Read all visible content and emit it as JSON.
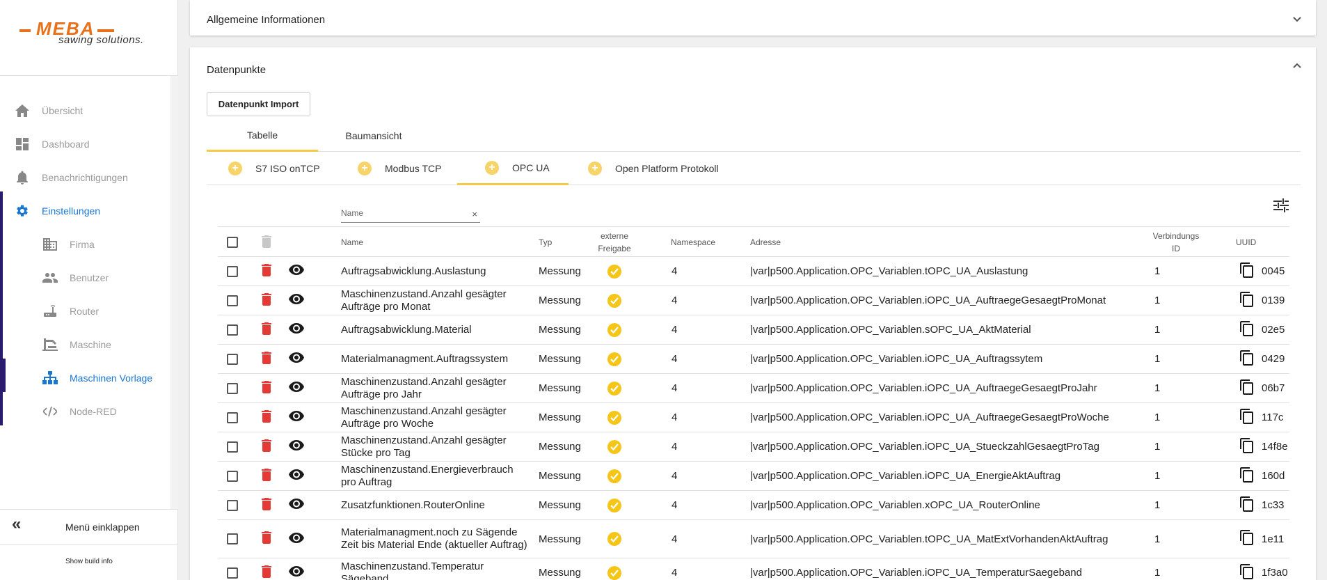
{
  "logo": {
    "brand": "MEBA",
    "tagline": "sawing solutions."
  },
  "sidebar": {
    "items": [
      {
        "label": "Übersicht",
        "icon": "home-icon"
      },
      {
        "label": "Dashboard",
        "icon": "dashboard-icon"
      },
      {
        "label": "Benachrichtigungen",
        "icon": "bell-icon"
      },
      {
        "label": "Einstellungen",
        "icon": "gear-icon"
      },
      {
        "label": "Firma",
        "icon": "building-icon"
      },
      {
        "label": "Benutzer",
        "icon": "users-icon"
      },
      {
        "label": "Router",
        "icon": "router-icon"
      },
      {
        "label": "Maschine",
        "icon": "saw-machine-icon"
      },
      {
        "label": "Maschinen Vorlage",
        "icon": "hierarchy-icon"
      },
      {
        "label": "Node-RED",
        "icon": "code-icon"
      }
    ],
    "collapse_label": "Menü einklappen",
    "build_info": "Show build info"
  },
  "panel_general": {
    "title": "Allgemeine Informationen"
  },
  "panel_datapoints": {
    "title": "Datenpunkte",
    "import_button": "Datenpunkt Import",
    "view_tabs": [
      "Tabelle",
      "Baumansicht"
    ],
    "protocol_tabs": [
      "S7 ISO onTCP",
      "Modbus TCP",
      "OPC UA",
      "Open Platform Protokoll"
    ],
    "filter": {
      "placeholder": "Name",
      "clear": "×"
    }
  },
  "table": {
    "headers": {
      "name": "Name",
      "type": "Typ",
      "external_1": "externe",
      "external_2": "Freigabe",
      "namespace": "Namespace",
      "address": "Adresse",
      "connection_1": "Verbindungs",
      "connection_2": "ID",
      "uuid": "UUID"
    },
    "rows": [
      {
        "name": "Auftragsabwicklung.Auslastung",
        "type": "Messung",
        "namespace": "4",
        "address": "|var|p500.Application.OPC_Variablen.tOPC_UA_Auslastung",
        "conn": "1",
        "uuid": "0045"
      },
      {
        "name": "Maschinenzustand.Anzahl gesägter Aufträge pro Monat",
        "type": "Messung",
        "namespace": "4",
        "address": "|var|p500.Application.OPC_Variablen.iOPC_UA_AuftraegeGesaegtProMonat",
        "conn": "1",
        "uuid": "0139"
      },
      {
        "name": "Auftragsabwicklung.Material",
        "type": "Messung",
        "namespace": "4",
        "address": "|var|p500.Application.OPC_Variablen.sOPC_UA_AktMaterial",
        "conn": "1",
        "uuid": "02e5"
      },
      {
        "name": "Materialmanagment.Auftragssystem",
        "type": "Messung",
        "namespace": "4",
        "address": "|var|p500.Application.OPC_Variablen.iOPC_UA_Auftragssytem",
        "conn": "1",
        "uuid": "0429"
      },
      {
        "name": "Maschinenzustand.Anzahl gesägter Aufträge pro Jahr",
        "type": "Messung",
        "namespace": "4",
        "address": "|var|p500.Application.OPC_Variablen.iOPC_UA_AuftraegeGesaegtProJahr",
        "conn": "1",
        "uuid": "06b7"
      },
      {
        "name": "Maschinenzustand.Anzahl gesägter Aufträge pro Woche",
        "type": "Messung",
        "namespace": "4",
        "address": "|var|p500.Application.OPC_Variablen.iOPC_UA_AuftraegeGesaegtProWoche",
        "conn": "1",
        "uuid": "117c"
      },
      {
        "name": "Maschinenzustand.Anzahl gesägter Stücke pro Tag",
        "type": "Messung",
        "namespace": "4",
        "address": "|var|p500.Application.OPC_Variablen.iOPC_UA_StueckzahlGesaegtProTag",
        "conn": "1",
        "uuid": "14f8e"
      },
      {
        "name": "Maschinenzustand.Energieverbrauch pro Auftrag",
        "type": "Messung",
        "namespace": "4",
        "address": "|var|p500.Application.OPC_Variablen.iOPC_UA_EnergieAktAuftrag",
        "conn": "1",
        "uuid": "160d"
      },
      {
        "name": "Zusatzfunktionen.RouterOnline",
        "type": "Messung",
        "namespace": "4",
        "address": "|var|p500.Application.OPC_Variablen.xOPC_UA_RouterOnline",
        "conn": "1",
        "uuid": "1c33"
      },
      {
        "name": "Materialmanagment.noch zu Sägende Zeit bis Material Ende (aktueller Auftrag)",
        "type": "Messung",
        "namespace": "4",
        "address": "|var|p500.Application.OPC_Variablen.tOPC_UA_MatExtVorhandenAktAuftrag",
        "conn": "1",
        "uuid": "1e11"
      },
      {
        "name": "Maschinenzustand.Temperatur Sägeband",
        "type": "Messung",
        "namespace": "4",
        "address": "|var|p500.Application.OPC_Variablen.iOPC_UA_TemperaturSaegeband",
        "conn": "1",
        "uuid": "1f3a0"
      }
    ]
  },
  "colors": {
    "accent": "#1976d2",
    "tab_indicator": "#f7c948",
    "delete": "#e53935",
    "badge": "#f5c518",
    "brand": "#e8721c",
    "nav_active_bar": "#2b1b6e"
  }
}
